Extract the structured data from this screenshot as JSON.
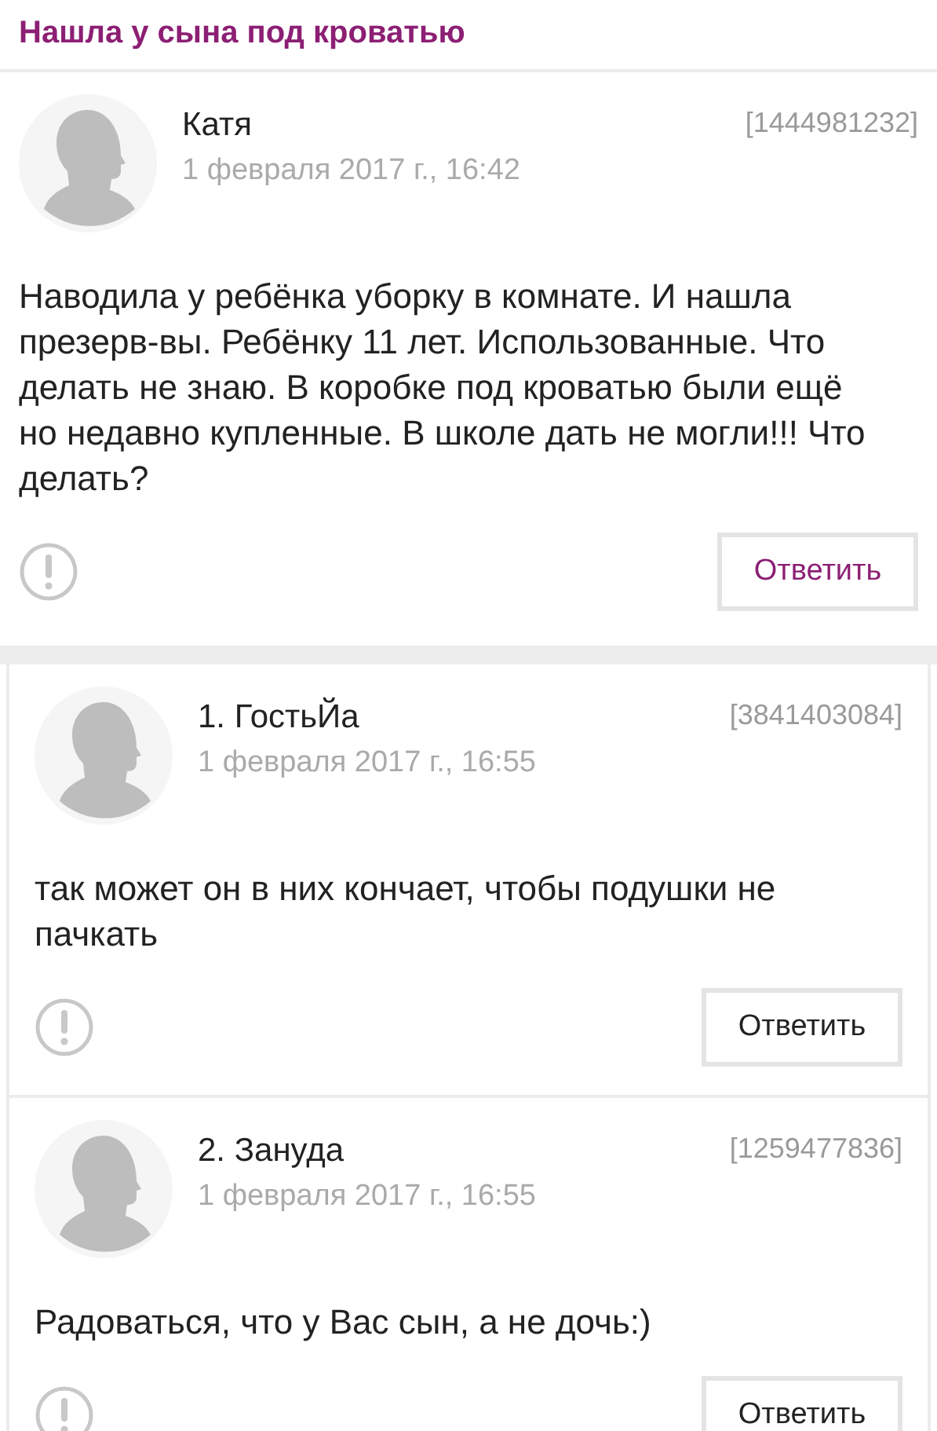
{
  "title": "Нашла у сына под кроватью",
  "posts": [
    {
      "kind": "topic",
      "author": "Катя",
      "date": "1 февраля 2017 г., 16:42",
      "id": "[1444981232]",
      "text": "Наводила у ребёнка уборку в комнате. И нашла презерв-вы. Ребёнку 11 лет. Использованные. Что делать не знаю. В коробке под кроватью были ещё но недавно купленные. В школе дать не могли!!! Что делать?",
      "reply": "Ответить"
    },
    {
      "kind": "comment",
      "author": "1. ГостьЙа",
      "date": "1 февраля 2017 г., 16:55",
      "id": "[3841403084]",
      "text": "так может он в них кончает, чтобы подушки не пачкать",
      "reply": "Ответить"
    },
    {
      "kind": "comment",
      "author": "2. Зануда",
      "date": "1 февраля 2017 г., 16:55",
      "id": "[1259477836]",
      "text": "Радоваться, что у Вас сын, а не дочь:)",
      "reply": "Ответить"
    }
  ]
}
